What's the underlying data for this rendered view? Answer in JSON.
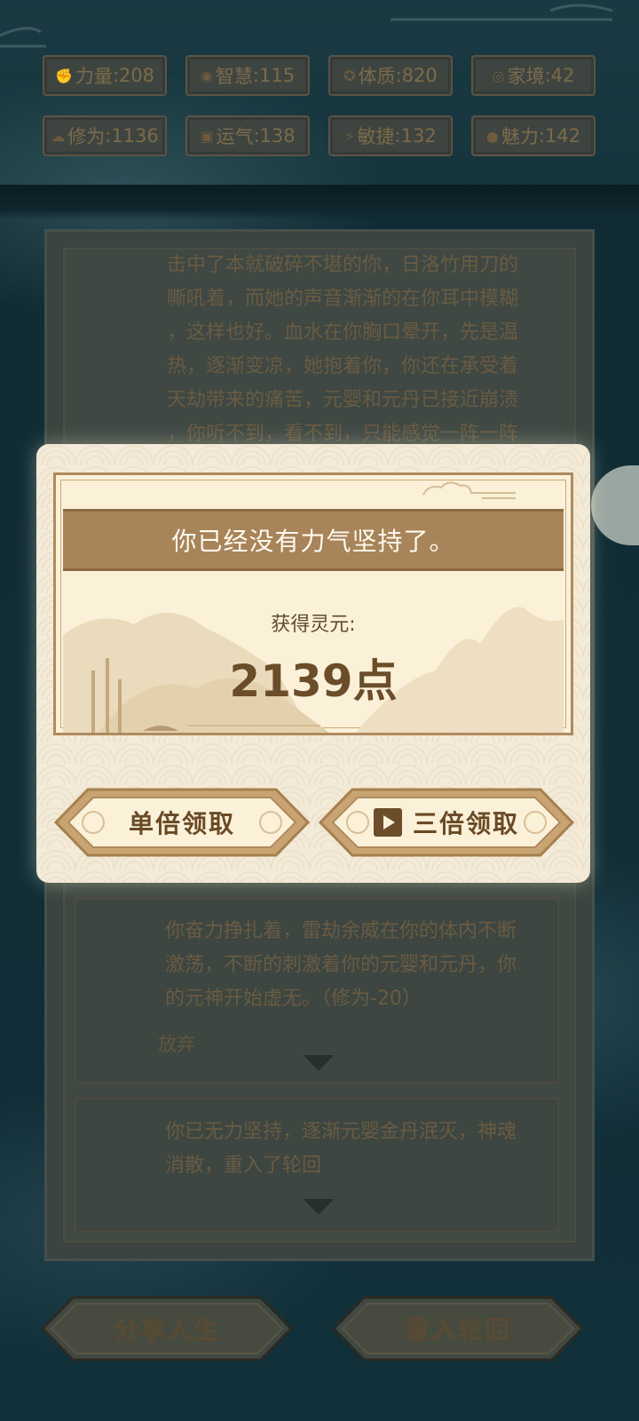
{
  "stats": [
    {
      "icon": "fist-icon",
      "glyph": "✊",
      "label": "力量",
      "sep": ":",
      "value": "208"
    },
    {
      "icon": "bulb-icon",
      "glyph": "◉",
      "label": "智慧",
      "sep": ":",
      "value": "115"
    },
    {
      "icon": "heart-icon",
      "glyph": "✪",
      "label": "体质",
      "sep": ":",
      "value": "820"
    },
    {
      "icon": "money-icon",
      "glyph": "◎",
      "label": "家境",
      "sep": ": ",
      "value": "42"
    },
    {
      "icon": "cloud-icon",
      "glyph": "☁",
      "label": "修为",
      "sep": ":",
      "value": "1136"
    },
    {
      "icon": "luck-icon",
      "glyph": "▣",
      "label": "运气",
      "sep": ":",
      "value": "138"
    },
    {
      "icon": "lightning-icon",
      "glyph": "⚡",
      "label": "敏捷",
      "sep": ":",
      "value": "132"
    },
    {
      "icon": "charm-icon",
      "glyph": "●",
      "label": "魅力",
      "sep": ":",
      "value": "142"
    }
  ],
  "story": {
    "lines": [
      "击中了本就破碎不堪的你，日洛竹用刀的",
      "嘶吼着，而她的声音渐渐的在你耳中模糊",
      "，这样也好。血水在你胸口晕开，先是温",
      "热，逐渐变凉，她抱着你，你还在承受着",
      "天劫带来的痛苦，元婴和元丹已接近崩溃",
      "，你听不到，看不到，只能感觉一阵一阵"
    ],
    "card1": {
      "lines": [
        "你奋力挣扎着，雷劫余威在你的体内不断",
        "激荡，不断的刺激着你的元婴和元丹，你",
        "的元神开始虚无。（修为-20）"
      ],
      "option": "放弃"
    },
    "card2": {
      "lines": [
        "你已无力坚持，逐渐元婴金丹泯灭，神魂",
        "消散，重入了轮回"
      ]
    }
  },
  "modal": {
    "message": "你已经没有力气坚持了。",
    "reward_label": "获得灵元:",
    "reward_points": "2139点",
    "single_button": "单倍领取",
    "triple_button": "三倍领取"
  },
  "bottom": {
    "share_button": "分享人生",
    "restart_button": "重入轮回"
  }
}
